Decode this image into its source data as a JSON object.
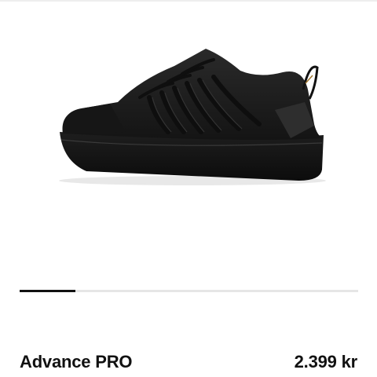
{
  "product": {
    "name": "Advance PRO",
    "price": "2.399 kr",
    "image_icon": "shoe-icon"
  },
  "carousel": {
    "progress_fraction": 0.165
  },
  "colors": {
    "text": "#111111",
    "track": "#e6e6e6",
    "indicator": "#111111",
    "shoe": "#1b1b1b"
  }
}
